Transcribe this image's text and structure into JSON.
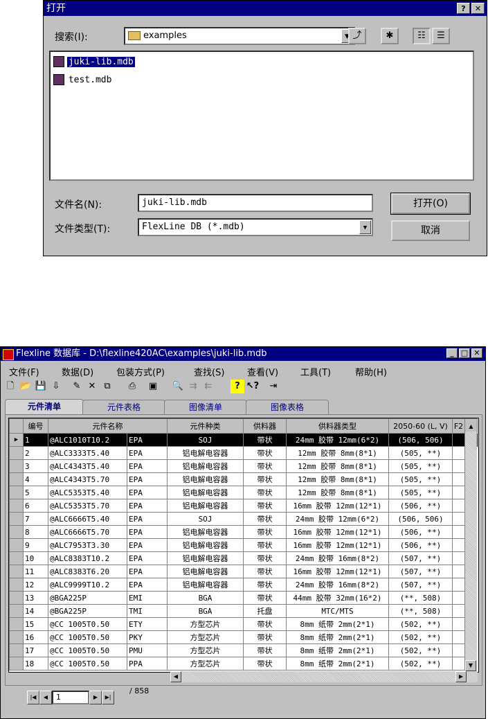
{
  "open_dialog": {
    "title": "打开",
    "help_btn": "?",
    "close_btn": "✕",
    "search_label": "搜索(I):",
    "location": "examples",
    "files": [
      "juki-lib.mdb",
      "test.mdb"
    ],
    "filename_label": "文件名(N):",
    "filename_value": "juki-lib.mdb",
    "filetype_label": "文件类型(T):",
    "filetype_value": "FlexLine DB (*.mdb)",
    "open_button": "打开(O)",
    "cancel_button": "取消"
  },
  "db_window": {
    "title": "Flexline 数据库 - D:\\flexline420AC\\examples\\juki-lib.mdb",
    "menu": [
      "文件(F)",
      "数据(D)",
      "包装方式(P)",
      "查找(S)",
      "查看(V)",
      "工具(T)",
      "帮助(H)"
    ],
    "tabs": [
      "元件清单",
      "元件表格",
      "图像清单",
      "图像表格"
    ],
    "columns": [
      "编号",
      "元件名称",
      "元件种类",
      "供料器",
      "供料器类型",
      "2050-60 (L, V)",
      "F2"
    ],
    "rows": [
      [
        "1",
        "@ALC1010T10.2",
        "EPA",
        "SOJ",
        "带状",
        "24mm 胶带 12mm(6*2)",
        "(506, 506)"
      ],
      [
        "2",
        "@ALC3333T5.40",
        "EPA",
        "铝电解电容器",
        "带状",
        "12mm 胶带 8mm(8*1)",
        "(505, **)"
      ],
      [
        "3",
        "@ALC4343T5.40",
        "EPA",
        "铝电解电容器",
        "带状",
        "12mm 胶带 8mm(8*1)",
        "(505, **)"
      ],
      [
        "4",
        "@ALC4343T5.70",
        "EPA",
        "铝电解电容器",
        "带状",
        "12mm 胶带 8mm(8*1)",
        "(505, **)"
      ],
      [
        "5",
        "@ALC5353T5.40",
        "EPA",
        "铝电解电容器",
        "带状",
        "12mm 胶带 8mm(8*1)",
        "(505, **)"
      ],
      [
        "6",
        "@ALC5353T5.70",
        "EPA",
        "铝电解电容器",
        "带状",
        "16mm 胶带 12mm(12*1)",
        "(506, **)"
      ],
      [
        "7",
        "@ALC6666T5.40",
        "EPA",
        "SOJ",
        "带状",
        "24mm 胶带 12mm(6*2)",
        "(506, 506)"
      ],
      [
        "8",
        "@ALC6666T5.70",
        "EPA",
        "铝电解电容器",
        "带状",
        "16mm 胶带 12mm(12*1)",
        "(506, **)"
      ],
      [
        "9",
        "@ALC7953T3.30",
        "EPA",
        "铝电解电容器",
        "带状",
        "16mm 胶带 12mm(12*1)",
        "(506, **)"
      ],
      [
        "10",
        "@ALC8383T10.2",
        "EPA",
        "铝电解电容器",
        "带状",
        "24mm 胶带 16mm(8*2)",
        "(507, **)"
      ],
      [
        "11",
        "@ALC8383T6.20",
        "EPA",
        "铝电解电容器",
        "带状",
        "16mm 胶带 12mm(12*1)",
        "(507, **)"
      ],
      [
        "12",
        "@ALC9999T10.2",
        "EPA",
        "铝电解电容器",
        "带状",
        "24mm 胶带 16mm(8*2)",
        "(507, **)"
      ],
      [
        "13",
        "@BGA225P",
        "EMI",
        "BGA",
        "带状",
        "44mm 胶带 32mm(16*2)",
        "(**, 508)"
      ],
      [
        "14",
        "@BGA225P",
        "TMI",
        "BGA",
        "托盘",
        "MTC/MTS",
        "(**, 508)"
      ],
      [
        "15",
        "@CC 1005T0.50",
        "ETY",
        "方型芯片",
        "带状",
        "8mm 纸带 2mm(2*1)",
        "(502, **)"
      ],
      [
        "16",
        "@CC 1005T0.50",
        "PKY",
        "方型芯片",
        "带状",
        "8mm 纸带 2mm(2*1)",
        "(502, **)"
      ],
      [
        "17",
        "@CC 1005T0.50",
        "PMU",
        "方型芯片",
        "带状",
        "8mm 纸带 2mm(2*1)",
        "(502, **)"
      ],
      [
        "18",
        "@CC 1005T0.50",
        "PPA",
        "方型芯片",
        "带状",
        "8mm 纸带 2mm(2*1)",
        "(502, **)"
      ]
    ],
    "nav": {
      "current": "1",
      "total": "/ 858"
    }
  }
}
